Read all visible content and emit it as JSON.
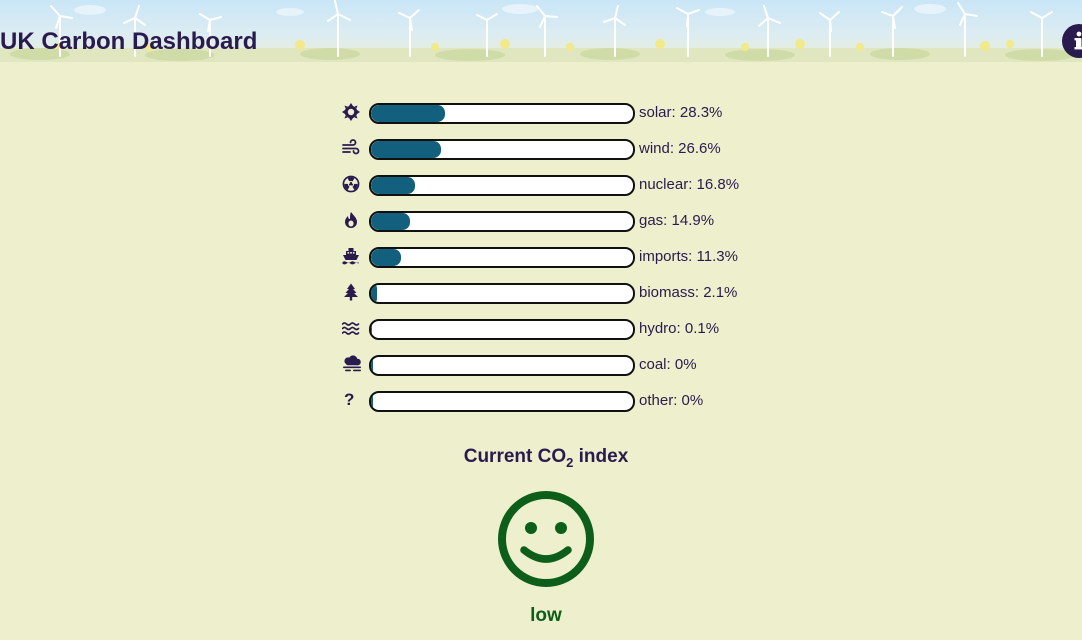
{
  "header": {
    "title": "UK Carbon Dashboard",
    "info_icon": "info-icon"
  },
  "generation_mix": [
    {
      "fuel": "solar",
      "label": "solar: 28.3%",
      "percent": 28.3,
      "icon": "sun-icon"
    },
    {
      "fuel": "wind",
      "label": "wind: 26.6%",
      "percent": 26.6,
      "icon": "wind-icon"
    },
    {
      "fuel": "nuclear",
      "label": "nuclear: 16.8%",
      "percent": 16.8,
      "icon": "radiation-icon"
    },
    {
      "fuel": "gas",
      "label": "gas: 14.9%",
      "percent": 14.9,
      "icon": "flame-icon"
    },
    {
      "fuel": "imports",
      "label": "imports: 11.3%",
      "percent": 11.3,
      "icon": "ship-icon"
    },
    {
      "fuel": "biomass",
      "label": "biomass: 2.1%",
      "percent": 2.1,
      "icon": "tree-icon"
    },
    {
      "fuel": "hydro",
      "label": "hydro: 0.1%",
      "percent": 0.1,
      "icon": "water-icon"
    },
    {
      "fuel": "coal",
      "label": "coal: 0%",
      "percent": 0,
      "icon": "smog-icon"
    },
    {
      "fuel": "other",
      "label": "other: 0%",
      "percent": 0,
      "icon": "question-icon",
      "glyph": "?"
    }
  ],
  "co2": {
    "heading_prefix": "Current CO",
    "heading_sub": "2",
    "heading_suffix": " index",
    "level": "low",
    "level_icon": "smiley-face-icon"
  },
  "colors": {
    "background": "#edefcd",
    "bar_fill": "#12607e",
    "text": "#2a1b4e",
    "co2_low": "#0d5e1a"
  }
}
